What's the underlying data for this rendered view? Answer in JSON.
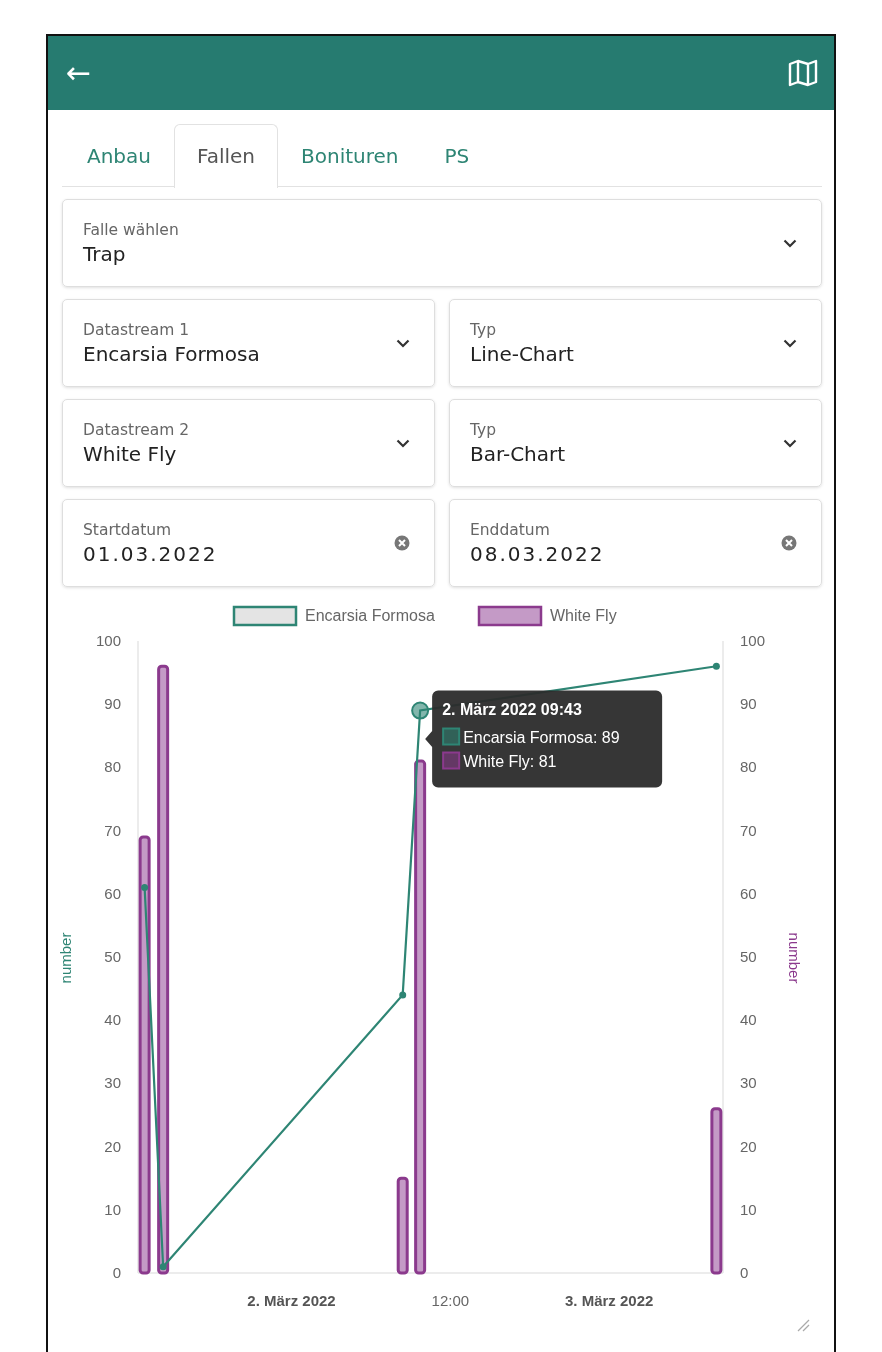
{
  "header": {
    "back_label": "←"
  },
  "tabs": [
    {
      "label": "Anbau",
      "selected": false
    },
    {
      "label": "Fallen",
      "selected": true
    },
    {
      "label": "Bonituren",
      "selected": false
    },
    {
      "label": "PS",
      "selected": false
    }
  ],
  "fields": [
    [
      {
        "kind": "select",
        "label": "Falle wählen",
        "value": "Trap"
      }
    ],
    [
      {
        "kind": "select",
        "label": "Datastream 1",
        "value": "Encarsia Formosa"
      },
      {
        "kind": "select",
        "label": "Typ",
        "value": "Line-Chart"
      }
    ],
    [
      {
        "kind": "select",
        "label": "Datastream 2",
        "value": "White Fly"
      },
      {
        "kind": "select",
        "label": "Typ",
        "value": "Bar-Chart"
      }
    ],
    [
      {
        "kind": "date",
        "label": "Startdatum",
        "value": "01.03.2022"
      },
      {
        "kind": "date",
        "label": "Enddatum",
        "value": "08.03.2022"
      }
    ]
  ],
  "chart_data": {
    "type": "bar",
    "ylabel": "number",
    "legend": "top",
    "x": [
      "2022-03-01T12:54",
      "2022-03-01T14:18",
      "2022-03-02T08:24",
      "2022-03-02T09:43",
      "2022-03-03T08:06"
    ],
    "xlim": [
      "2022-03-01T12:24",
      "2022-03-03T08:36"
    ],
    "xticks": [
      {
        "value": "2022-03-02T00:00",
        "label": "2. März 2022"
      },
      {
        "value": "2022-03-02T12:00",
        "label": "12:00"
      },
      {
        "value": "2022-03-03T00:00",
        "label": "3. März 2022"
      }
    ],
    "ylim": [
      0,
      100
    ],
    "yticks": [
      0,
      10,
      20,
      30,
      40,
      50,
      60,
      70,
      80,
      90,
      100
    ],
    "series": [
      {
        "name": "Encarsia Formosa",
        "type": "line",
        "marker": "circle",
        "color": "#2e8574",
        "values": [
          61,
          1,
          44,
          89,
          96
        ]
      },
      {
        "name": "White Fly",
        "color": "#8b3a8d",
        "values": [
          69,
          96,
          15,
          81,
          26
        ]
      }
    ]
  },
  "x_tick_bold": [
    true,
    false,
    true
  ],
  "right_axis": {
    "title": "number",
    "ticks": [
      "100",
      "90",
      "80",
      "70",
      "60",
      "50",
      "40",
      "30",
      "20",
      "10",
      "0"
    ]
  },
  "tooltip": {
    "title": "2. März 2022 09:43",
    "hovered": [
      false,
      false,
      false,
      true,
      false
    ],
    "items": [
      "Encarsia Formosa: 89",
      "White Fly: 81"
    ]
  }
}
